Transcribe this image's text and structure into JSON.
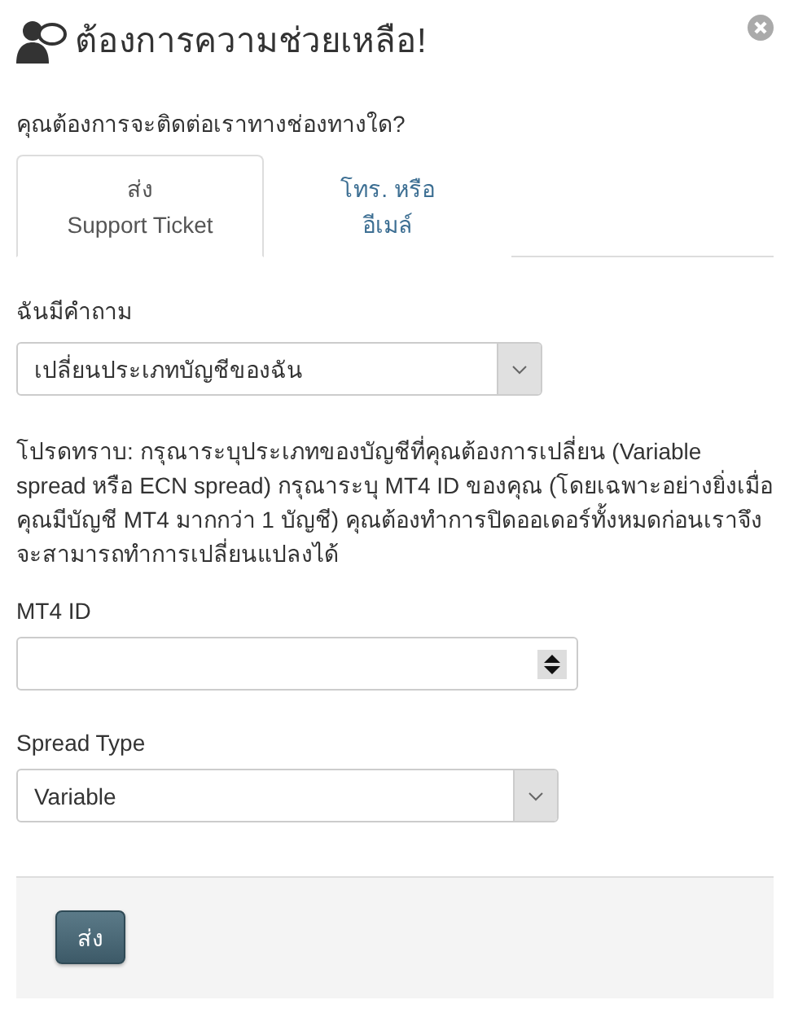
{
  "dialog": {
    "title": "ต้องการความช่วยเหลือ!"
  },
  "question": "คุณต้องการจะติดต่อเราทางช่องทางใด?",
  "tabs": [
    {
      "lines": [
        "ส่ง",
        "Support Ticket"
      ],
      "selected": true
    },
    {
      "lines": [
        "โทร. หรือ",
        "อีเมล์"
      ],
      "selected": false
    }
  ],
  "topic": {
    "label": "ฉันมีคำถาม",
    "value": "เปลี่ยนประเภทบัญชีของฉัน"
  },
  "note": "โปรดทราบ: กรุณาระบุประเภทของบัญชีที่คุณต้องการเปลี่ยน (Variable spread หรือ ECN spread) กรุณาระบุ MT4 ID ของคุณ (โดยเฉพาะอย่างยิ่งเมื่อคุณมีบัญชี MT4 มากกว่า 1 บัญชี) คุณต้องทำการปิดออเดอร์ทั้งหมดก่อนเราจึงจะสามารถทำการเปลี่ยนแปลงได้",
  "mt4_id": {
    "label": "MT4 ID"
  },
  "spread_type": {
    "label": "Spread Type",
    "value": "Variable"
  },
  "submit": "ส่ง"
}
